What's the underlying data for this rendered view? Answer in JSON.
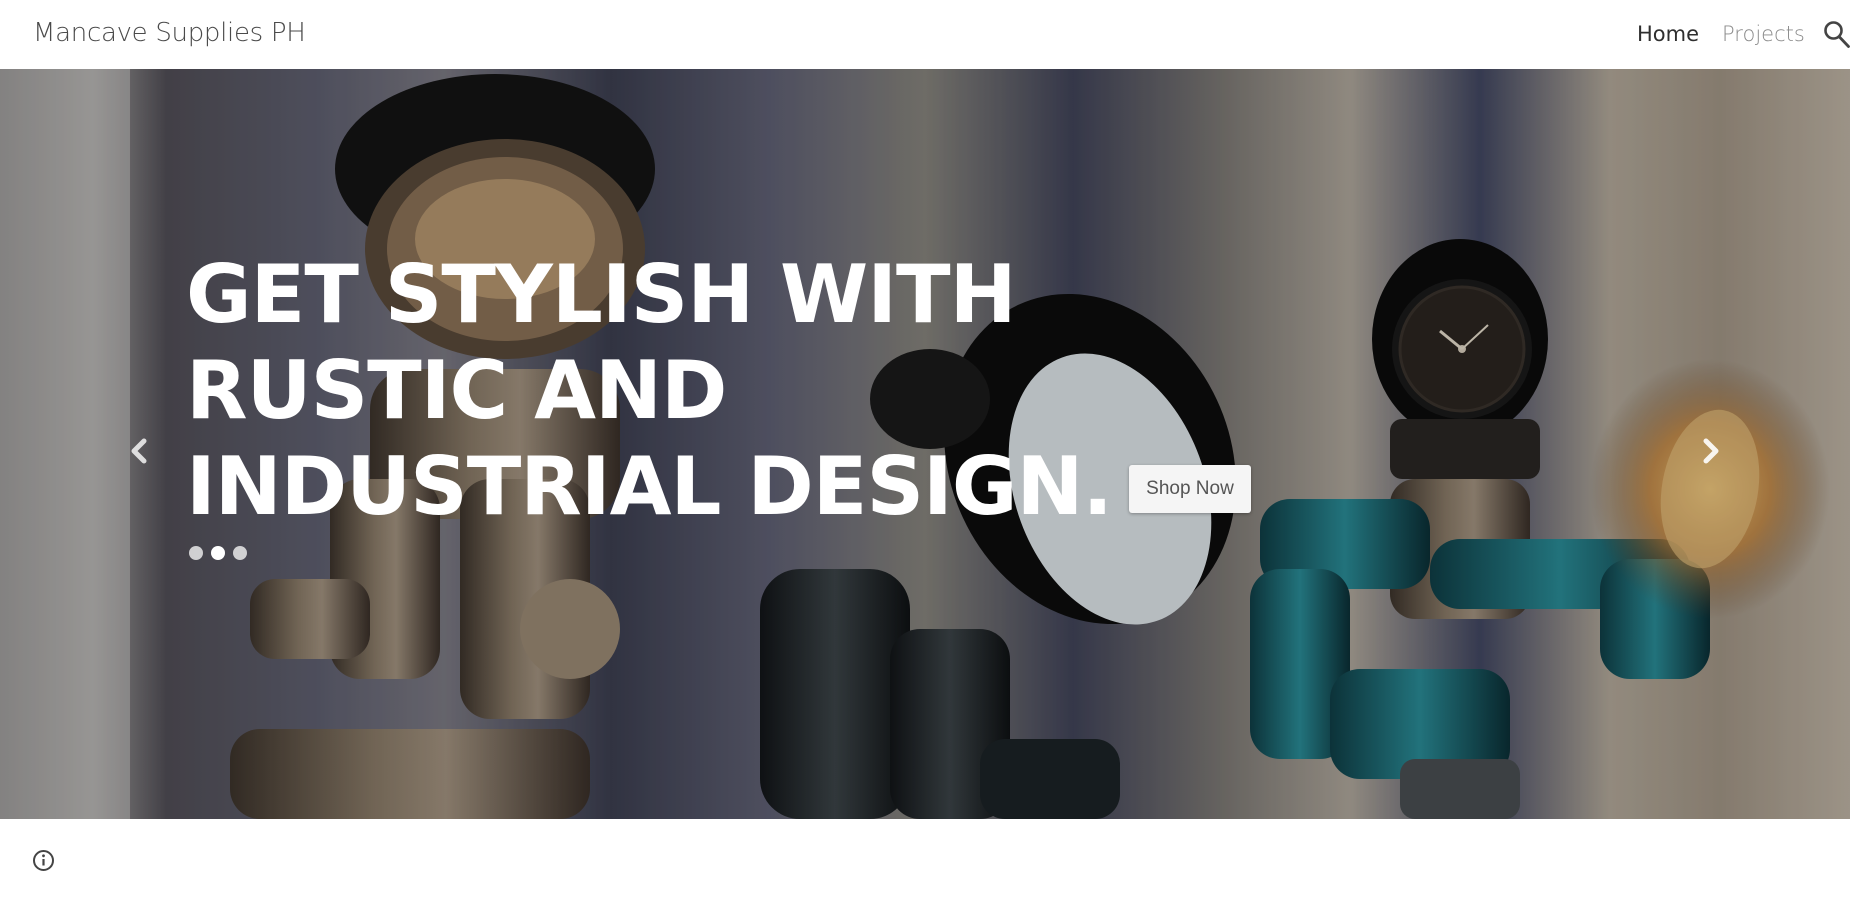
{
  "header": {
    "site_title": "Mancave Supplies PH",
    "nav": [
      {
        "label": "Home",
        "active": true
      },
      {
        "label": "Projects",
        "active": false
      }
    ],
    "search_icon": "search-icon"
  },
  "hero": {
    "headline_lines": [
      "GET STYLISH WITH",
      "RUSTIC AND",
      "INDUSTRIAL DESIGN."
    ],
    "cta_label": "Shop Now",
    "carousel_dots": 3,
    "active_dot": 1,
    "prev_icon": "chevron-left-icon",
    "next_icon": "chevron-right-icon",
    "background_image": "industrial pipe lamps photo"
  },
  "footer": {
    "info_icon": "info-icon"
  },
  "colors": {
    "title_text": "#4a4a4a",
    "nav_active": "#2f2f2f",
    "nav_inactive": "#8a8a8a",
    "button_bg": "#f5f5f5",
    "teal_accent": "#2a8c97"
  }
}
